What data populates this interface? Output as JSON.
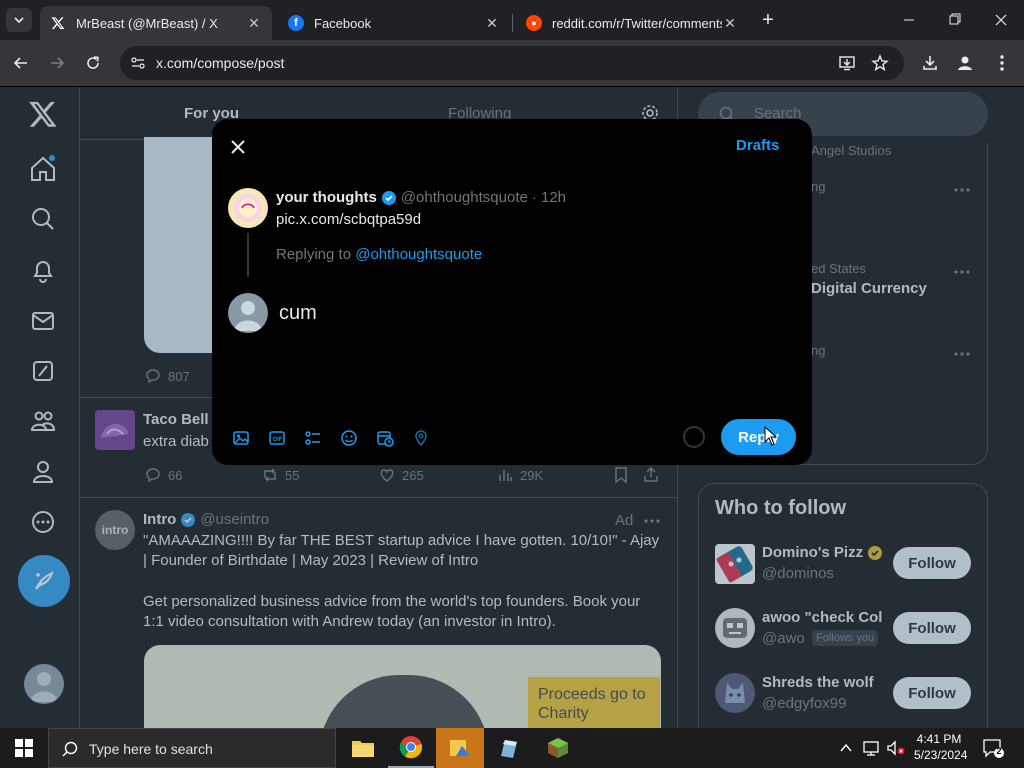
{
  "browser": {
    "tabs": [
      {
        "title": "MrBeast (@MrBeast) / X",
        "favicon": "x-logo-icon",
        "active": true
      },
      {
        "title": "Facebook",
        "favicon": "facebook-icon",
        "active": false
      },
      {
        "title": "reddit.com/r/Twitter/comments/",
        "favicon": "reddit-icon",
        "active": false
      }
    ],
    "url": "x.com/compose/post"
  },
  "feed": {
    "tabs": [
      "For you",
      "Following"
    ],
    "post1": {
      "replies": "807"
    },
    "post2": {
      "name": "Taco Bell",
      "text": "extra diab",
      "replies": "66",
      "reposts": "55",
      "likes": "265",
      "views": "29K"
    },
    "post3": {
      "name": "Intro",
      "handle": "@useintro",
      "ad_label": "Ad",
      "text1": "\"AMAAAZING!!!! By far THE BEST startup advice I have gotten. 10/10!\" - Ajay | Founder of Birthdate | May 2023 | Review of Intro",
      "text2": "Get personalized business advice from the world's top founders. Book your 1:1 video consultation with Andrew today (an investor in Intro).",
      "image_caption": "Proceeds go to Charity",
      "avatar_text": "intro"
    }
  },
  "sidebar": {
    "search_placeholder": "Search",
    "trends": [
      {
        "meta": "Angel Studios",
        "title": ""
      },
      {
        "meta": "ng",
        "title": ""
      },
      {
        "meta": "ed States",
        "title": "Digital Currency"
      },
      {
        "meta": "ng",
        "title": ""
      }
    ],
    "who_to_follow_title": "Who to follow",
    "suggestions": [
      {
        "name": "Domino's Pizz",
        "handle": "@dominos",
        "button": "Follow",
        "follows_you": ""
      },
      {
        "name": "awoo \"check Col",
        "handle": "@awo",
        "button": "Follow",
        "follows_you": "Follows you"
      },
      {
        "name": "Shreds the wolf",
        "handle": "@edgyfox99",
        "button": "Follow",
        "follows_you": ""
      }
    ]
  },
  "modal": {
    "drafts_label": "Drafts",
    "original": {
      "name": "your thoughts",
      "handle": "@ohthoughtsquote",
      "time": "· 12h",
      "text": "pic.x.com/scbqtpa59d"
    },
    "replying_prefix": "Replying to",
    "replying_to": "@ohthoughtsquote",
    "reply_text": "cum",
    "reply_button": "Reply",
    "accent": "#1d9bf0"
  },
  "taskbar": {
    "search_placeholder": "Type here to search",
    "time": "4:41 PM",
    "date": "5/23/2024",
    "notifications": "2"
  }
}
